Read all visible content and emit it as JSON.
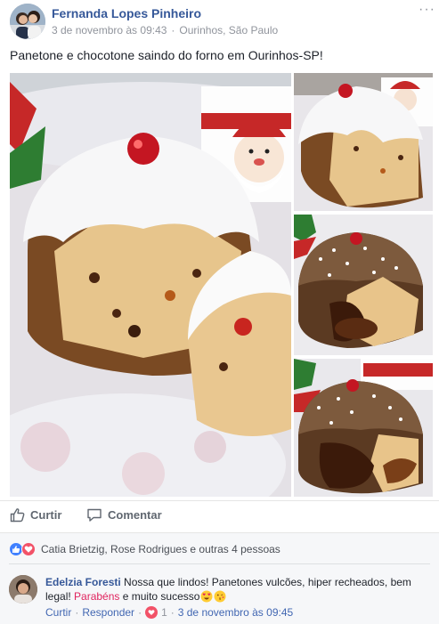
{
  "post": {
    "author": "Fernanda Lopes Pinheiro",
    "date": "3 de novembro às 09:43",
    "separator": "·",
    "location": "Ourinhos, São Paulo",
    "more_label": "···",
    "caption": "Panetone e chocotone saindo do forno em Ourinhos-SP!"
  },
  "photos": [
    {
      "icon": "panettone-photo"
    },
    {
      "icon": "panettone-photo"
    },
    {
      "icon": "chocottone-photo"
    },
    {
      "icon": "chocottone-photo"
    }
  ],
  "actions": {
    "like_label": "Curtir",
    "comment_label": "Comentar"
  },
  "reactions": {
    "text": "Catia Brietzig, Rose Rodrigues e outras 4 pessoas"
  },
  "comment": {
    "author": "Edelzia Foresti",
    "text_before": "Nossa que lindos! Panetones vulcões, hiper recheados, bem legal! ",
    "highlight": "Parabéns",
    "text_after": " e muito sucesso",
    "like_label": "Curtir",
    "reply_label": "Responder",
    "reaction_count": "1",
    "timestamp": "3 de novembro às 09:45",
    "separator": "·"
  },
  "colors": {
    "author_link": "#365899",
    "meta_gray": "#90949c",
    "like_blue": "#4080ff",
    "love_red": "#f25268",
    "highlight": "#e0245e"
  }
}
